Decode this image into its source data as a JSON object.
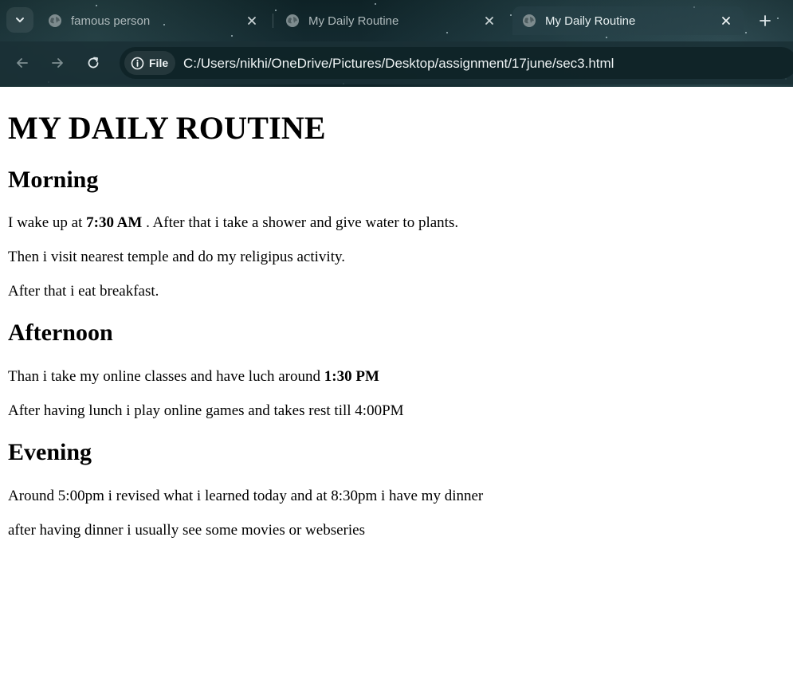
{
  "browser": {
    "tabs": [
      {
        "title": "famous person",
        "active": false
      },
      {
        "title": "My Daily Routine",
        "active": false
      },
      {
        "title": "My Daily Routine",
        "active": true
      }
    ],
    "site_info_label": "File",
    "url": "C:/Users/nikhi/OneDrive/Pictures/Desktop/assignment/17june/sec3.html",
    "icons": {
      "tab_search": "chevron-down-icon",
      "favicon": "globe-icon",
      "close": "close-icon",
      "new_tab": "plus-icon",
      "back": "back-arrow-icon",
      "forward": "forward-arrow-icon",
      "reload": "reload-icon",
      "site_info": "info-icon"
    }
  },
  "page": {
    "heading": "MY DAILY ROUTINE",
    "morning": {
      "heading": "Morning",
      "p1_before": "I wake up at ",
      "p1_bold": "7:30 AM",
      "p1_after": " . After that i take a shower and give water to plants.",
      "p2": "Then i visit nearest temple and do my religipus activity.",
      "p3": "After that i eat breakfast."
    },
    "afternoon": {
      "heading": "Afternoon",
      "p1_before": "Than i take my online classes and have luch around ",
      "p1_bold": "1:30 PM",
      "p2": "After having lunch i play online games and takes rest till 4:00PM"
    },
    "evening": {
      "heading": "Evening",
      "p1": "Around 5:00pm i revised what i learned today and at 8:30pm i have my dinner",
      "p2": "after having dinner i usually see some movies or webseries"
    }
  },
  "colors": {
    "chrome_bg": "#142a30",
    "tab_text": "#aeb9bb",
    "active_tab_text": "#e6eeef",
    "page_bg": "#ffffff",
    "text": "#000000"
  }
}
